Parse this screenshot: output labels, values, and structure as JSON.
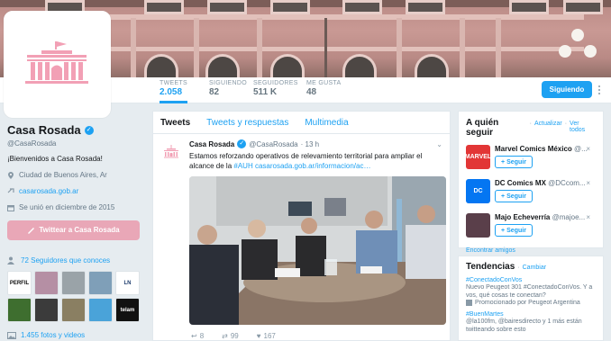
{
  "profile": {
    "name": "Casa Rosada",
    "handle": "@CasaRosada",
    "bio": "¡Bienvenidos a Casa Rosada!",
    "location": "Ciudad de Buenos Aires, Ar",
    "website": "casarosada.gob.ar",
    "joined": "Se unió en diciembre de 2015",
    "tweet_to_label": "Twittear a Casa Rosada",
    "known_followers": "72 Seguidores que conoces",
    "photos_videos": "1.455 fotos y videos"
  },
  "stats": [
    {
      "label": "TWEETS",
      "value": "2.058"
    },
    {
      "label": "SIGUIENDO",
      "value": "82"
    },
    {
      "label": "SEGUIDORES",
      "value": "511 K"
    },
    {
      "label": "ME GUSTA",
      "value": "48"
    }
  ],
  "follow_button": "Siguiendo",
  "known_tiles": [
    {
      "text": "PERFIL",
      "bg": "#ffffff",
      "fg": "#111111"
    },
    {
      "text": "",
      "bg": "#b58fa4",
      "fg": "#fff"
    },
    {
      "text": "",
      "bg": "#9aa3a8",
      "fg": "#fff"
    },
    {
      "text": "",
      "bg": "#7f9fb8",
      "fg": "#fff"
    },
    {
      "text": "LN",
      "bg": "#ffffff",
      "fg": "#1b3a6b"
    },
    {
      "text": "",
      "bg": "#3e6e2f",
      "fg": "#fff"
    },
    {
      "text": "",
      "bg": "#3b3b3b",
      "fg": "#fff"
    },
    {
      "text": "",
      "bg": "#8a7f62",
      "fg": "#fff"
    },
    {
      "text": "",
      "bg": "#4aa3d9",
      "fg": "#fff"
    },
    {
      "text": "telam",
      "bg": "#111111",
      "fg": "#ffffff"
    }
  ],
  "tabs": [
    "Tweets",
    "Tweets y respuestas",
    "Multimedia"
  ],
  "tweet": {
    "name": "Casa Rosada",
    "handle": "@CasaRosada",
    "time": "· 13 h",
    "text": "Estamos reforzando operativos de relevamiento territorial para ampliar el alcance de la ",
    "text_link": "#AUH casarosada.gob.ar/informacion/ac…",
    "replies": "8",
    "retweets": "99",
    "likes": "167"
  },
  "who_to_follow": {
    "title": "A quién seguir",
    "refresh": "Actualizar",
    "view_all": "Ver todos",
    "follow_label": "Seguir",
    "find_friends": "Encontrar amigos",
    "items": [
      {
        "name": "Marvel Comics México",
        "handle": "@...",
        "badge": "MARVEL",
        "color": "#e23636"
      },
      {
        "name": "DC Comics MX",
        "handle": "@DCcom...",
        "badge": "DC",
        "color": "#0476f2"
      },
      {
        "name": "Majo Echeverría",
        "handle": "@majoe...",
        "badge": "",
        "color": "#5a3f4a"
      }
    ]
  },
  "trends": {
    "title": "Tendencias",
    "change": "Cambiar",
    "items": [
      {
        "tag": "#ConectadoConVos",
        "desc": "Nuevo Peugeot 301 #ConectadoConVos. Y a vos, qué cosas te conectan?",
        "promo": "Promocionado por Peugeot Argentina"
      },
      {
        "tag": "#BuenMartes",
        "desc": "@la100fm, @bairesdirecto y 1 más están twitteando sobre esto",
        "promo": ""
      }
    ]
  },
  "colors": {
    "accent": "#1da1f2",
    "brand_pink": "#e9a7b7"
  }
}
